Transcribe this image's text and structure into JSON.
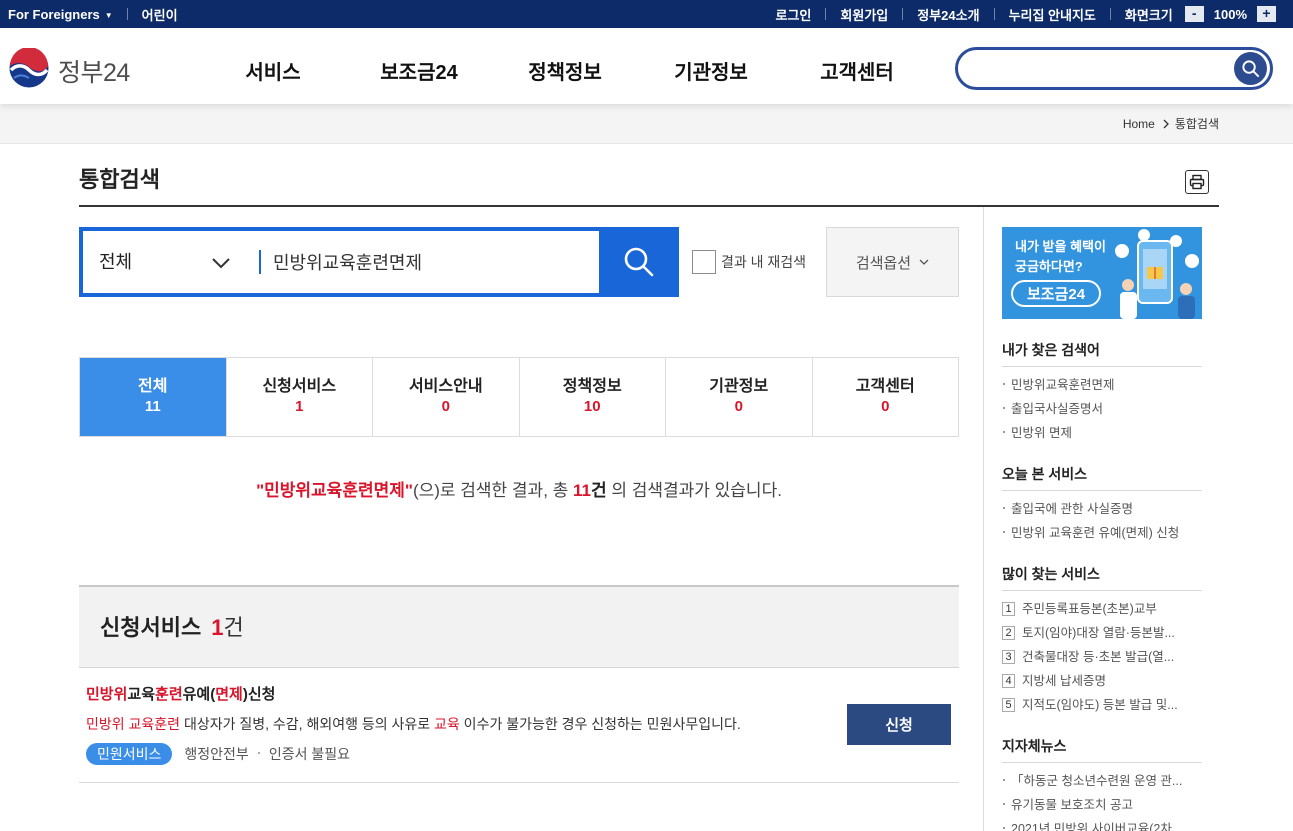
{
  "topbar": {
    "foreigners_label": "For Foreigners",
    "kids_label": "어린이",
    "login": "로그인",
    "signup": "회원가입",
    "about": "정부24소개",
    "sitemap": "누리집 안내지도",
    "screen_size": "화면크기",
    "zoom_out": "-",
    "zoom_level": "100%",
    "zoom_in": "+"
  },
  "header": {
    "logo_text": "정부24",
    "nav": [
      "서비스",
      "보조금24",
      "정책정보",
      "기관정보",
      "고객센터"
    ]
  },
  "breadcrumb": {
    "home": "Home",
    "current": "통합검색"
  },
  "page": {
    "title": "통합검색"
  },
  "search": {
    "category": "전체",
    "query": "민방위교육훈련면제",
    "research_label": "결과 내 재검색",
    "research_checked": false,
    "options_label": "검색옵션"
  },
  "tabs": [
    {
      "label": "전체",
      "count": "11",
      "active": true
    },
    {
      "label": "신청서비스",
      "count": "1",
      "active": false
    },
    {
      "label": "서비스안내",
      "count": "0",
      "active": false
    },
    {
      "label": "정책정보",
      "count": "10",
      "active": false
    },
    {
      "label": "기관정보",
      "count": "0",
      "active": false
    },
    {
      "label": "고객센터",
      "count": "0",
      "active": false
    }
  ],
  "summary": {
    "query": "\"민방위교육훈련면제\"",
    "middle": "(으)로 검색한 결과, 총 ",
    "total": "11",
    "unit": "건",
    "tail": " 의 검색결과가 있습니다."
  },
  "section": {
    "title": "신청서비스",
    "count": "1",
    "unit": "건"
  },
  "results": [
    {
      "title_parts": [
        {
          "text": "민방위",
          "hl": true
        },
        {
          "text": "교육",
          "hl": false
        },
        {
          "text": "훈련",
          "hl": true
        },
        {
          "text": "유예(",
          "hl": false
        },
        {
          "text": "면제",
          "hl": true
        },
        {
          "text": ")신청",
          "hl": false
        }
      ],
      "desc_parts": [
        {
          "text": "민방위 교육훈련",
          "hl": true
        },
        {
          "text": " 대상자가 질병, 수감, 해외여행 등의 사유로 ",
          "hl": false
        },
        {
          "text": "교육",
          "hl": true
        },
        {
          "text": " 이수가 불가능한 경우 신청하는 민원사무입니다.",
          "hl": false
        }
      ],
      "tag": "민원서비스",
      "org": "행정안전부",
      "cert": "인증서 불필요",
      "apply_label": "신청"
    }
  ],
  "sidebar": {
    "banner": {
      "line1": "내가 받을 혜택이",
      "line2": "궁금하다면?",
      "badge": "보조금24"
    },
    "recent_searches": {
      "title": "내가 찾은 검색어",
      "items": [
        "민방위교육훈련면제",
        "출입국사실증명서",
        "민방위 면제"
      ]
    },
    "viewed_today": {
      "title": "오늘 본 서비스",
      "items": [
        "출입국에 관한 사실증명",
        "민방위 교육훈련 유예(면제) 신청"
      ]
    },
    "popular": {
      "title": "많이 찾는 서비스",
      "items": [
        {
          "rank": "1",
          "text": "주민등록표등본(초본)교부"
        },
        {
          "rank": "2",
          "text": "토지(임야)대장 열람·등본발..."
        },
        {
          "rank": "3",
          "text": "건축물대장 등·초본 발급(열..."
        },
        {
          "rank": "4",
          "text": "지방세 납세증명"
        },
        {
          "rank": "5",
          "text": "지적도(임야도) 등본 발급 및..."
        }
      ]
    },
    "local_news": {
      "title": "지자체뉴스",
      "items": [
        "「하동군 청소년수련원 운영 관...",
        "유기동물 보호조치 공고",
        "2021년 민방위 사이버교육(2차"
      ]
    }
  },
  "icons": {
    "logo": "government-emblem-icon",
    "header_search": "search-icon",
    "main_search": "search-icon",
    "print": "print-icon",
    "dropdown": "chevron-down-icon",
    "breadcrumb": "chevron-right-icon"
  },
  "colors": {
    "topbar_bg": "#0c2b68",
    "accent": "#1966d8",
    "tab_active": "#3b8ee8",
    "highlight_red": "#d8152b",
    "apply_button": "#2b4a82"
  }
}
